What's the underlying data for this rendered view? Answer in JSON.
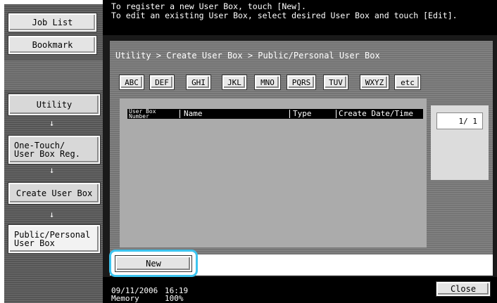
{
  "left_nav": {
    "job_list_label": "Job List",
    "bookmark_label": "Bookmark",
    "path": [
      {
        "label": "Utility"
      },
      {
        "label": "One-Touch/\nUser Box Reg."
      },
      {
        "label": "Create User Box"
      },
      {
        "label": "Public/Personal\nUser Box"
      }
    ],
    "arrow_glyph": "↓"
  },
  "message": {
    "line1": "To register a new User Box, touch [New].",
    "line2": "To edit an existing User Box, select desired User Box and touch [Edit]."
  },
  "breadcrumb": "Utility > Create User Box > Public/Personal User Box",
  "index_tabs": [
    "ABC",
    "DEF",
    "GHI",
    "JKL",
    "MNO",
    "PQRS",
    "TUV",
    "WXYZ",
    "etc"
  ],
  "list": {
    "columns": {
      "number": "User Box\nNumber",
      "name": "Name",
      "type": "Type",
      "date": "Create Date/Time"
    },
    "rows": []
  },
  "pagination": "1/ 1",
  "new_button_label": "New",
  "close_button_label": "Close",
  "status": {
    "date": "09/11/2006",
    "time": "16:19",
    "memory_label": "Memory",
    "memory_value": "100%"
  },
  "colors": {
    "highlight": "#3cc4ef",
    "panel_gray": "#7b7b7b",
    "bar_black": "#000000"
  }
}
